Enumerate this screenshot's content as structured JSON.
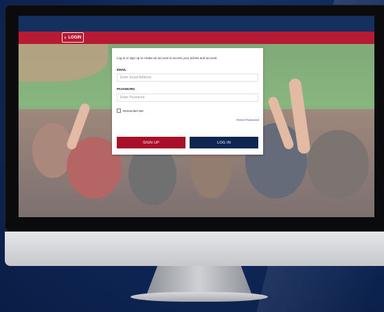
{
  "navbar": {
    "back_label": "LOGIN"
  },
  "login_card": {
    "intro": "Log in or sign up to create an account to access your tickets and account.",
    "email_label": "EMAIL",
    "email_placeholder": "Enter Email Address",
    "password_label": "PASSWORD",
    "password_placeholder": "Enter Password",
    "remember_label": "Remember Me",
    "reset_label": "Reset Password",
    "signup_label": "SIGN UP",
    "login_label": "LOG IN"
  },
  "colors": {
    "background": "#0c2350",
    "navbar": "#b61b33",
    "signup_button": "#a8102a",
    "login_button": "#0f2653"
  },
  "icons": {
    "back": "chevron-left-icon"
  }
}
